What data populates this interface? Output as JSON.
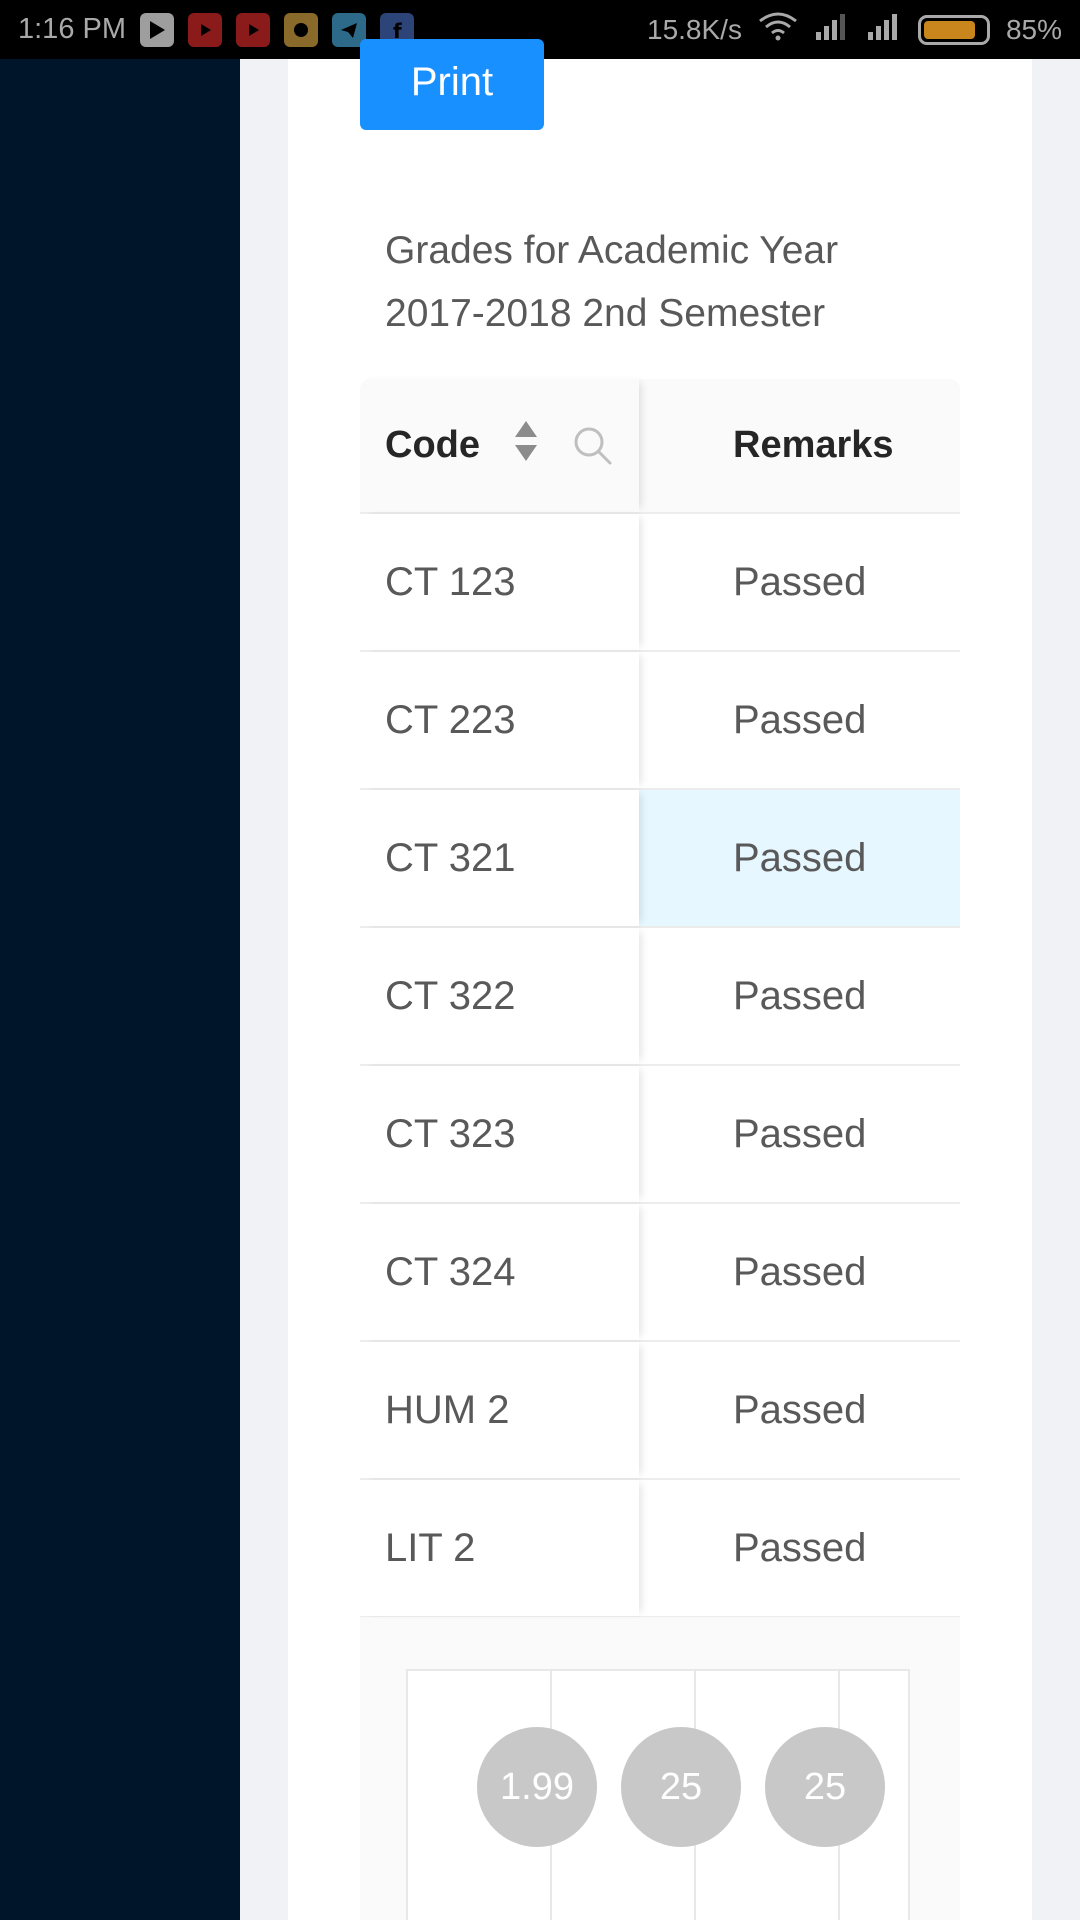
{
  "status_bar": {
    "time": "1:16 PM",
    "net_speed": "15.8K/s",
    "battery_pct": "85%",
    "battery_level": 0.85,
    "notification_icons": [
      "play-store-icon",
      "youtube-icon",
      "youtube-icon",
      "messenger-icon",
      "telegram-icon",
      "facebook-icon"
    ]
  },
  "toolbar": {
    "print_label": "Print"
  },
  "page": {
    "title": "Grades for Academic Year 2017-2018 2nd Semester"
  },
  "table": {
    "columns": [
      {
        "key": "code",
        "label": "Code",
        "sortable": true,
        "filterable": true
      },
      {
        "key": "remarks",
        "label": "Remarks"
      }
    ],
    "rows": [
      {
        "code": "CT 123",
        "remarks": "Passed"
      },
      {
        "code": "CT 223",
        "remarks": "Passed"
      },
      {
        "code": "CT 321",
        "remarks": "Passed"
      },
      {
        "code": "CT 322",
        "remarks": "Passed"
      },
      {
        "code": "CT 323",
        "remarks": "Passed"
      },
      {
        "code": "CT 324",
        "remarks": "Passed"
      },
      {
        "code": "HUM 2",
        "remarks": "Passed"
      },
      {
        "code": "LIT 2",
        "remarks": "Passed"
      }
    ]
  },
  "summary": {
    "values": [
      "1.99",
      "25",
      "25"
    ]
  },
  "colors": {
    "primary": "#1890ff",
    "sidebar": "#001529",
    "row_highlight": "#e6f7ff"
  }
}
